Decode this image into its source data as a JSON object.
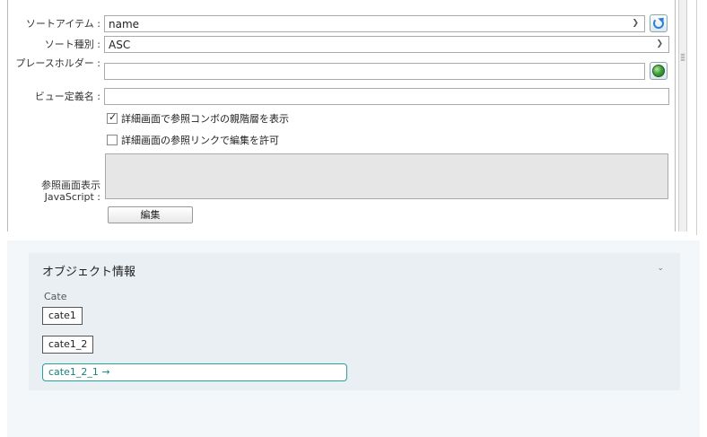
{
  "form": {
    "sort_item_label": "ソートアイテム :",
    "sort_item_value": "name",
    "sort_type_label": "ソート種別 :",
    "sort_type_value": "ASC",
    "placeholder_label": "プレースホルダー :",
    "placeholder_value": "",
    "view_def_label": "ビュー定義名 :",
    "view_def_value": "",
    "check_show_parent": {
      "label": "詳細画面で参照コンボの親階層を表示",
      "checked": true
    },
    "check_allow_edit": {
      "label": "詳細画面の参照リンクで編集を許可",
      "checked": false
    },
    "js_label": "参照画面表示JavaScript :",
    "edit_button": "編集"
  },
  "object_info": {
    "title": "オブジェクト情報",
    "field_label": "Cate",
    "items": [
      "cate1",
      "cate1_2"
    ],
    "link_item": "cate1_2_1 →"
  },
  "icons": {
    "refresh": "refresh-icon",
    "globe": "globe-icon",
    "dropdown": "chevron-down-icon"
  },
  "colors": {
    "accent": "#2aa09a",
    "card_bg": "#e9eff2"
  }
}
